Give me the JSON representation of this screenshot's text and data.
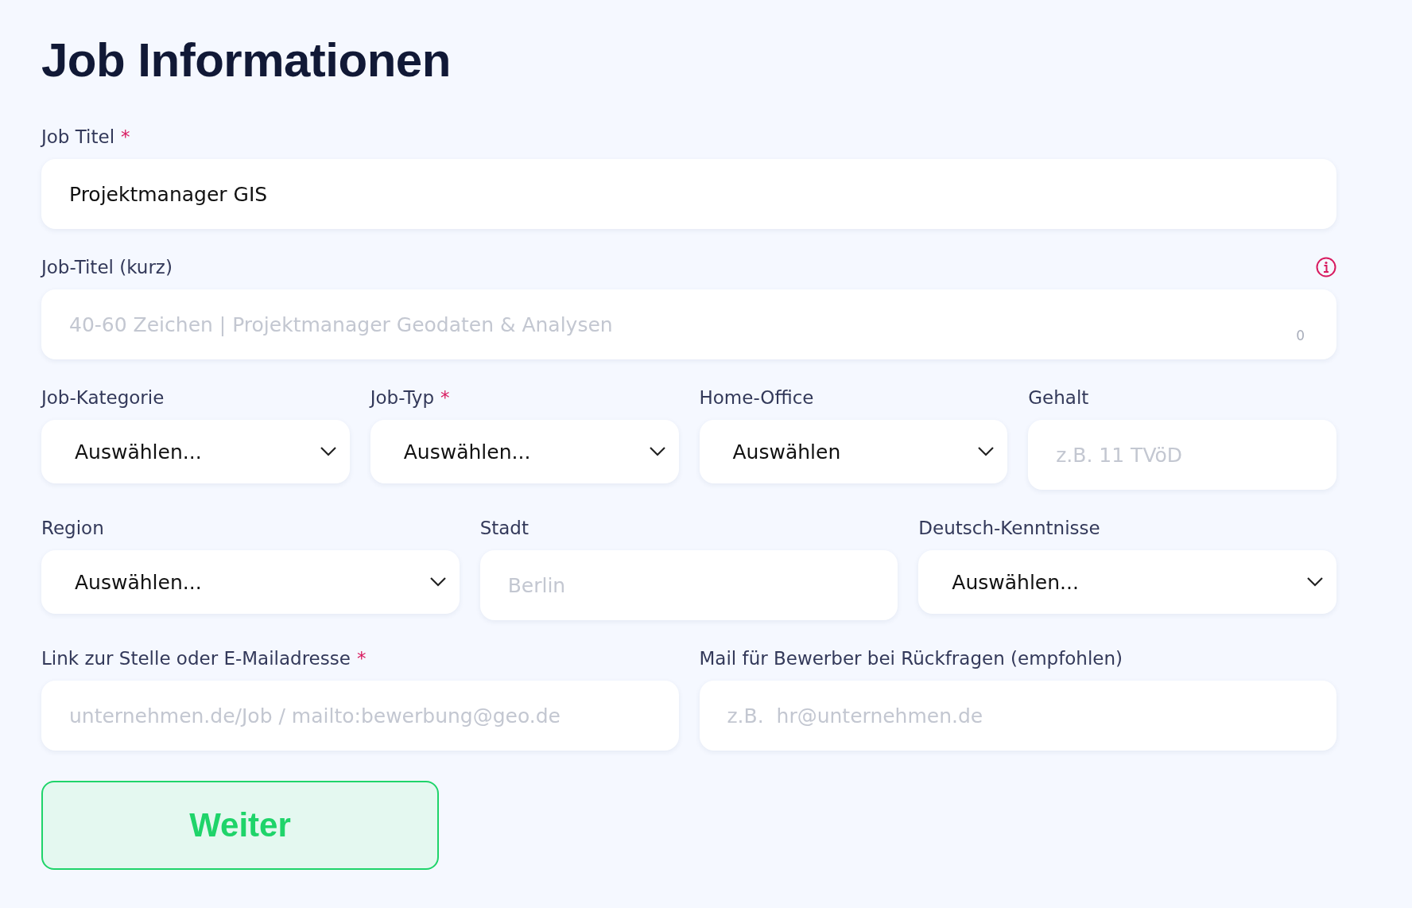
{
  "title": "Job Informationen",
  "rows": [
    {
      "fields": [
        {
          "label": "Job Titel",
          "required_mark": "*",
          "kind": "text",
          "value": "Projektmanager GIS"
        }
      ]
    },
    {
      "fields": [
        {
          "label": "Job-Titel (kurz)",
          "kind": "text",
          "info": true,
          "placeholder": "40-60 Zeichen | Projektmanager Geodaten & Analysen",
          "counter": "0"
        }
      ]
    },
    {
      "fields": [
        {
          "label": "Job-Kategorie",
          "kind": "select",
          "value": "Auswählen..."
        },
        {
          "label": "Job-Typ",
          "required_mark": "*",
          "kind": "select",
          "value": "Auswählen..."
        },
        {
          "label": "Home-Office",
          "kind": "select",
          "value": "Auswählen"
        },
        {
          "label": "Gehalt",
          "kind": "text",
          "placeholder": "z.B. 11 TVöD"
        }
      ]
    },
    {
      "fields": [
        {
          "label": "Region",
          "kind": "select",
          "value": "Auswählen..."
        },
        {
          "label": "Stadt",
          "kind": "text",
          "placeholder": "Berlin"
        },
        {
          "label": "Deutsch-Kenntnisse",
          "kind": "select",
          "value": "Auswählen..."
        }
      ]
    },
    {
      "fields": [
        {
          "label": "Link zur Stelle oder E-Mailadresse",
          "required_mark": "*",
          "kind": "text",
          "placeholder": "unternehmen.de/Job / mailto:bewerbung@geo.de"
        },
        {
          "label": "Mail für Bewerber bei Rückfragen (empfohlen)",
          "kind": "text",
          "placeholder": "z.B.  hr@unternehmen.de"
        }
      ]
    }
  ],
  "button": "Weiter"
}
